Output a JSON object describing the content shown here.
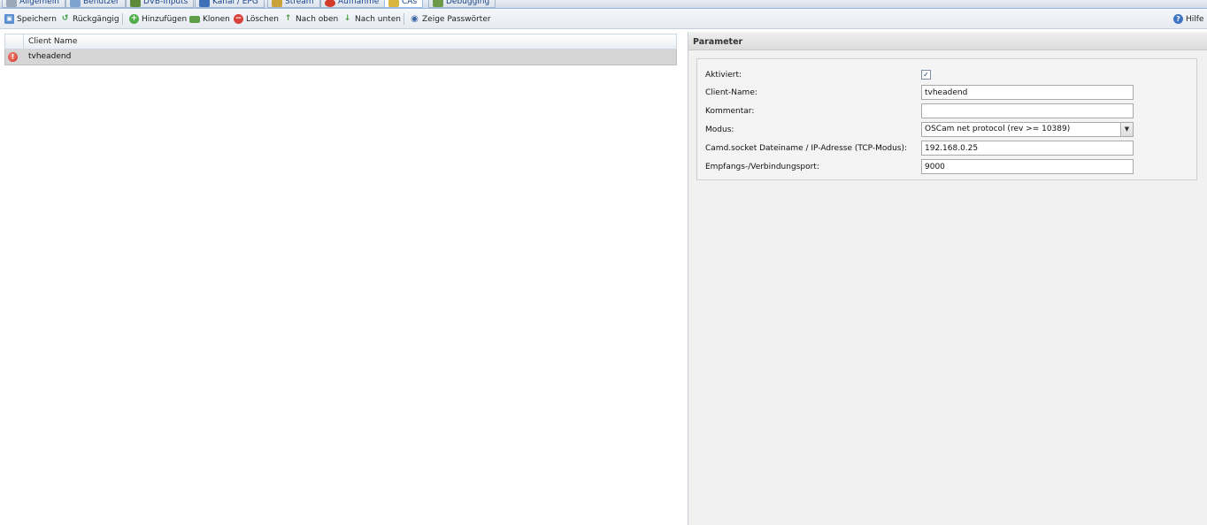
{
  "tabs": [
    {
      "label": "Allgemein",
      "icon": "wrench-icon"
    },
    {
      "label": "Benutzer",
      "icon": "users-icon"
    },
    {
      "label": "DVB-Inputs",
      "icon": "tv-icon"
    },
    {
      "label": "Kanal / EPG",
      "icon": "list-icon"
    },
    {
      "label": "Stream",
      "icon": "stream-icon"
    },
    {
      "label": "Aufnahme",
      "icon": "record-icon"
    },
    {
      "label": "CAs",
      "icon": "key-icon"
    },
    {
      "label": "Debugging",
      "icon": "bug-icon"
    }
  ],
  "toolbar": {
    "save": "Speichern",
    "undo": "Rückgängig",
    "add": "Hinzufügen",
    "clone": "Klonen",
    "delete": "Löschen",
    "move_up": "Nach oben",
    "move_down": "Nach unten",
    "show_passwords": "Zeige Passwörter",
    "help": "Hilfe"
  },
  "grid": {
    "column_header": "Client Name",
    "rows": [
      {
        "name": "tvheadend",
        "status_icon": "error-icon"
      }
    ]
  },
  "parameters": {
    "title": "Parameter",
    "enabled_label": "Aktiviert:",
    "enabled": true,
    "client_name_label": "Client-Name:",
    "client_name_value": "tvheadend",
    "comment_label": "Kommentar:",
    "comment_value": "",
    "mode_label": "Modus:",
    "mode_value": "OSCam net protocol (rev >= 10389)",
    "socket_label": "Camd.socket Dateiname / IP-Adresse (TCP-Modus):",
    "socket_value": "192.168.0.25",
    "port_label": "Empfangs-/Verbindungsport:",
    "port_value": "9000"
  },
  "colors": {
    "selected_row": "#d5d5d5",
    "header_text": "#15428b",
    "error_red": "#cc2a1c"
  }
}
